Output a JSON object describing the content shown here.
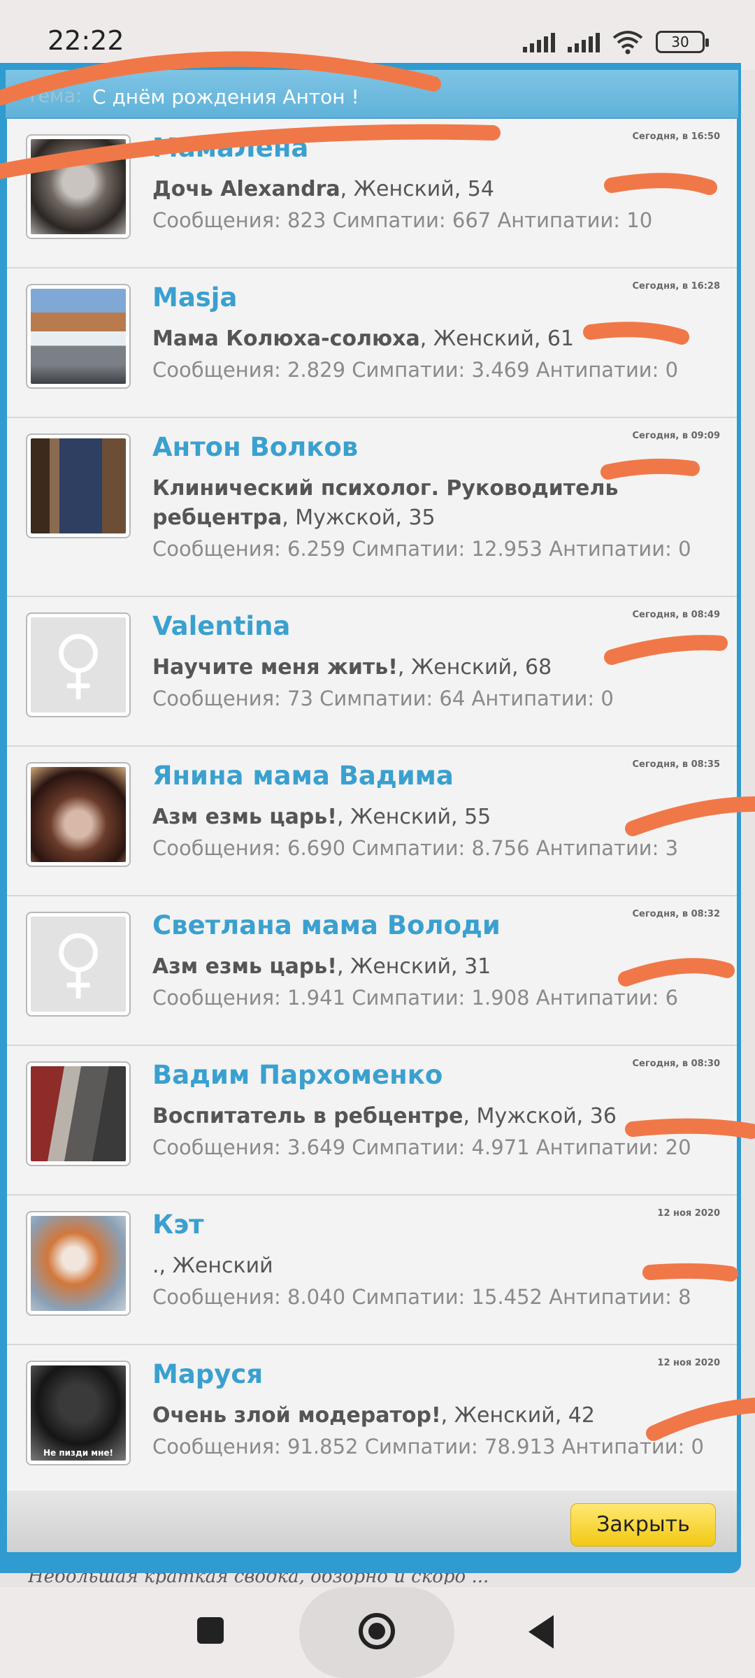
{
  "status": {
    "time": "22:22",
    "battery": "30"
  },
  "topic": {
    "label": "Тема:",
    "text": "С днём рождения Антон !"
  },
  "users": [
    {
      "name": "МамаЛена",
      "title": "Дочь Alexandra",
      "details": ", Женский, 54",
      "stats": "Сообщения: 823 Симпатии: 667 Антипатии: 10",
      "date": "Сегодня, в 16:50"
    },
    {
      "name": "Masja",
      "title": "Мама Колюха-солюха",
      "details": ", Женский, 61",
      "stats": "Сообщения: 2.829 Симпатии: 3.469 Антипатии: 0",
      "date": "Сегодня, в 16:28"
    },
    {
      "name": "Антон Волков",
      "title": "Клинический психолог. Руководитель ребцентра",
      "details": ", Мужской, 35",
      "stats": "Сообщения: 6.259 Симпатии: 12.953 Антипатии: 0",
      "date": "Сегодня, в 09:09"
    },
    {
      "name": "Valentina",
      "title": "Научите меня жить!",
      "details": ", Женский, 68",
      "stats": "Сообщения: 73 Симпатии: 64 Антипатии: 0",
      "date": "Сегодня, в 08:49"
    },
    {
      "name": "Янина мама Вадима",
      "title": "Азм езмь царь!",
      "details": ", Женский, 55",
      "stats": "Сообщения: 6.690 Симпатии: 8.756 Антипатии: 3",
      "date": "Сегодня, в 08:35"
    },
    {
      "name": "Светлана мама Володи",
      "title": "Азм езмь царь!",
      "details": ", Женский, 31",
      "stats": "Сообщения: 1.941 Симпатии: 1.908 Антипатии: 6",
      "date": "Сегодня, в 08:32"
    },
    {
      "name": "Вадим Пархоменко",
      "title": "Воспитатель в ребцентре",
      "details": ", Мужской, 36",
      "stats": "Сообщения: 3.649 Симпатии: 4.971 Антипатии: 20",
      "date": "Сегодня, в 08:30"
    },
    {
      "name": "Кэт",
      "title": ".",
      "details": ", Женский",
      "stats": "Сообщения: 8.040 Симпатии: 15.452 Антипатии: 8",
      "date": "12 ноя 2020"
    },
    {
      "name": "Маруся",
      "title": "Очень злой модератор!",
      "details": ", Женский, 42",
      "stats": "Сообщения: 91.852 Симпатии: 78.913 Антипатии: 0",
      "date": "12 ноя 2020",
      "avatar_caption": "Не пизди мне!"
    }
  ],
  "footer": {
    "close_label": "Закрыть"
  },
  "below_text": "Небольшая краткая сводка, обзорно и скоро ..."
}
